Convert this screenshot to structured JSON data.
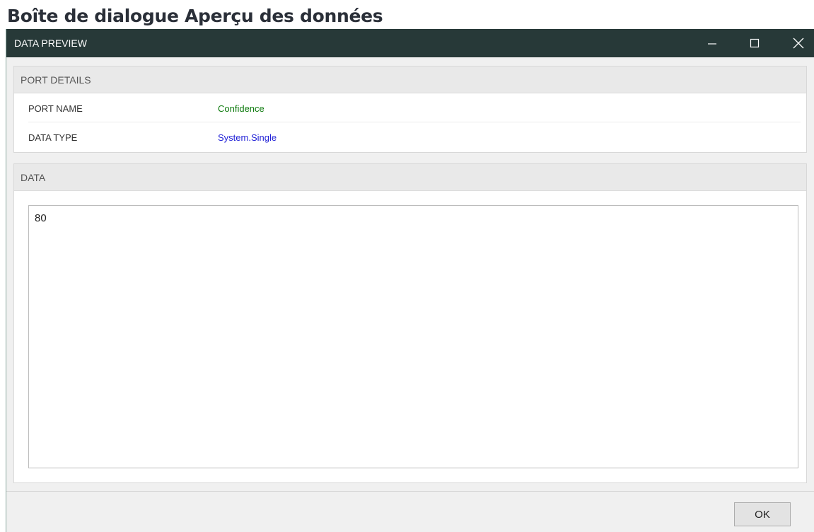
{
  "page": {
    "heading": "Boîte de dialogue Aperçu des données"
  },
  "window": {
    "title": "DATA PREVIEW",
    "controls": {
      "minimize_icon": "minimize-icon",
      "maximize_icon": "maximize-icon",
      "close_icon": "close-icon"
    }
  },
  "port_details": {
    "header": "PORT DETAILS",
    "rows": [
      {
        "label": "PORT NAME",
        "value": "Confidence",
        "value_color": "#0d7a0d"
      },
      {
        "label": "DATA TYPE",
        "value": "System.Single",
        "value_color": "#1f1fd6"
      }
    ]
  },
  "data_section": {
    "header": "DATA",
    "content": "80"
  },
  "footer": {
    "ok_label": "OK"
  },
  "colors": {
    "titlebar": "#273938",
    "panel_header": "#e9e9e9",
    "window_background": "#f0f0f0"
  }
}
